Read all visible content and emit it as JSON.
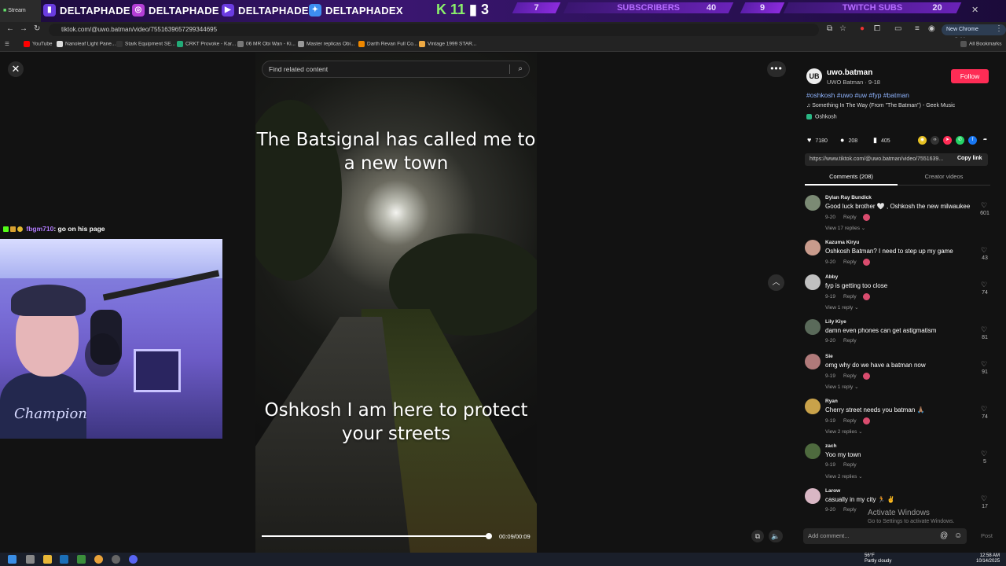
{
  "tab": {
    "title": "Stream"
  },
  "overlay": {
    "socials": [
      "DELTAPHADE",
      "DELTAPHADE",
      "DELTAPHADE",
      "DELTAPHADEX"
    ],
    "goal_prefix": "K 11",
    "goal_count": "3",
    "subscribers": {
      "current": "7",
      "label": "SUBSCRIBERS",
      "target": "40"
    },
    "twitch_subs": {
      "current": "9",
      "label": "TWITCH SUBS",
      "target": "20"
    }
  },
  "browser": {
    "url": "tiktok.com/@uwo.batman/video/7551639657299344695",
    "new_chrome": "New Chrome available",
    "bookmarks": [
      "YouTube",
      "Nanoleaf Light Pane...",
      "Stark Equipment SE...",
      "CRKT Provoke - Kar...",
      "06 MR Obi Wan - Ki...",
      "Master replicas Obi...",
      "Darth Revan Full Co...",
      "Vintage 1999 STAR..."
    ],
    "all_bookmarks": "All Bookmarks"
  },
  "search": {
    "placeholder": "Find related content"
  },
  "video": {
    "caption_top": "The Batsignal has called me to a new town",
    "caption_bottom": "Oshkosh I am here to protect your streets",
    "time": "00:09/00:09",
    "progress": 1.0
  },
  "stream_chat": {
    "user": "fbgm710",
    "message": ": go on his page"
  },
  "webcam": {
    "shirt_text": "Champion"
  },
  "post": {
    "avatar": "UB",
    "username": "uwo.batman",
    "display": "UWO Batman · 9-18",
    "follow": "Follow",
    "hashtags": "#oshkosh #uwo #uw #fyp #batman",
    "music": "Something In The Way (From \"The Batman\") - Geek Music",
    "location": "Oshkosh",
    "likes": "7180",
    "comments": "208",
    "saves": "405",
    "link": "https://www.tiktok.com/@uwo.batman/video/7551639...",
    "copy_link": "Copy link"
  },
  "tabs": {
    "comments": "Comments (208)",
    "creator": "Creator videos"
  },
  "comments": [
    {
      "name": "Dylan Ray Bundick",
      "text": "Good luck brother 🤍 , Oshkosh the new milwaukee",
      "date": "9-20",
      "reply": "Reply",
      "views": "View 17 replies ⌄",
      "likes": "601",
      "color": "#7b8a74"
    },
    {
      "name": "Kazuma Kiryu",
      "text": "Oshkosh Batman? I need to step up my game",
      "date": "9-20",
      "reply": "Reply",
      "views": "",
      "likes": "43",
      "color": "#c99b8c"
    },
    {
      "name": "Abby",
      "text": "fyp is getting too close",
      "date": "9-19",
      "reply": "Reply",
      "views": "View 1 reply ⌄",
      "likes": "74",
      "color": "#c0c0c0"
    },
    {
      "name": "Lily Kiye",
      "text": "damn even phones can get astigmatism",
      "date": "9-20",
      "reply": "Reply",
      "views": "",
      "likes": "81",
      "color": "#5a6a5a"
    },
    {
      "name": "Sie",
      "text": "omg why do we have a batman now",
      "date": "9-19",
      "reply": "Reply",
      "views": "View 1 reply ⌄",
      "likes": "91",
      "color": "#b07a7a"
    },
    {
      "name": "Ryan",
      "text": "Cherry street needs you batman 🙏🏽",
      "date": "9-19",
      "reply": "Reply",
      "views": "View 2 replies ⌄",
      "likes": "74",
      "color": "#c9a24a"
    },
    {
      "name": "zach",
      "text": "Yoo my town",
      "date": "9-19",
      "reply": "Reply",
      "views": "View 2 replies ⌄",
      "likes": "5",
      "color": "#4e6a3e"
    },
    {
      "name": "Larow",
      "text": "casually in my city 🏃 ✌️",
      "date": "9-20",
      "reply": "Reply",
      "views": "",
      "likes": "17",
      "color": "#d9b7c4"
    }
  ],
  "add_comment": {
    "placeholder": "Add comment...",
    "post": "Post"
  },
  "watermark": {
    "title": "Activate Windows",
    "sub": "Go to Settings to activate Windows."
  },
  "taskbar": {
    "weather_temp": "56°F",
    "weather_desc": "Partly cloudy",
    "time": "12:58 AM",
    "date": "10/14/2025"
  }
}
